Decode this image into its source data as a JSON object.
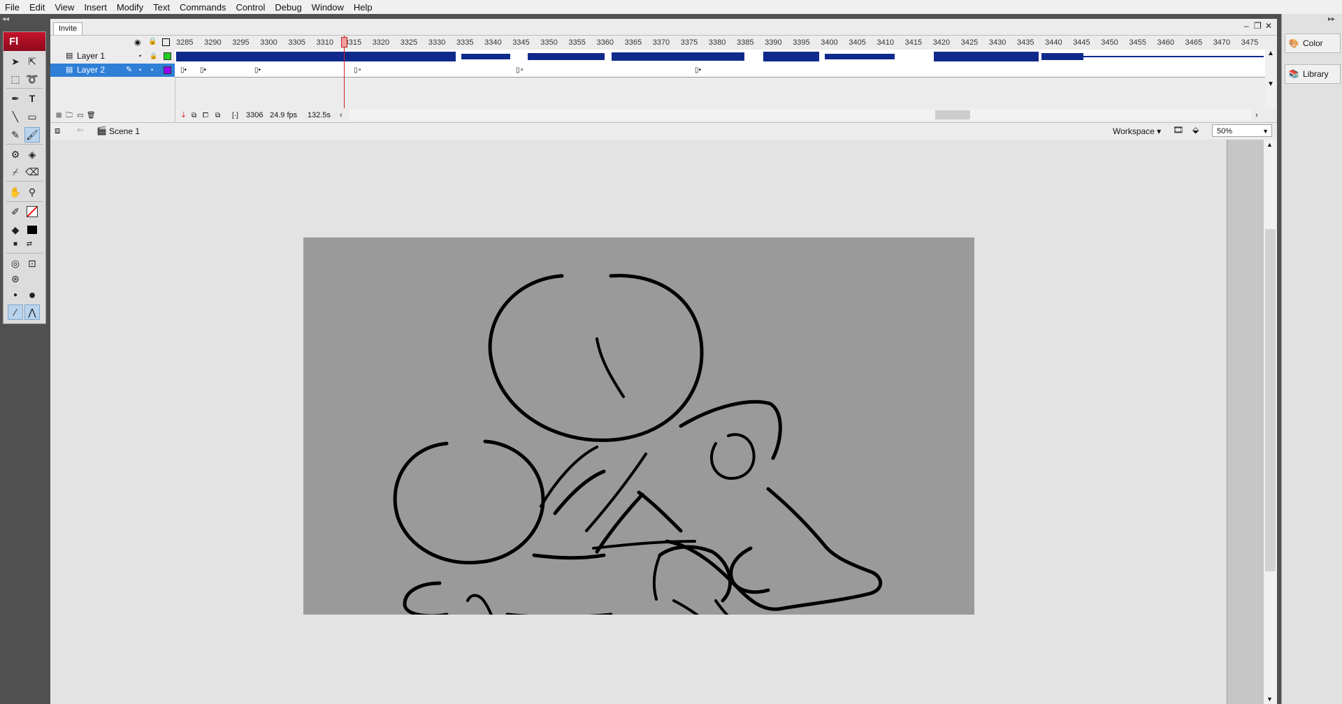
{
  "menu": [
    "File",
    "Edit",
    "View",
    "Insert",
    "Modify",
    "Text",
    "Commands",
    "Control",
    "Debug",
    "Window",
    "Help"
  ],
  "tools": {
    "logo": "Fl"
  },
  "document": {
    "tab": "Invite"
  },
  "timeline": {
    "layers": [
      {
        "name": "Layer 1",
        "color": "#22cc22",
        "selected": false
      },
      {
        "name": "Layer 2",
        "color": "#9900ff",
        "selected": true
      }
    ],
    "frame_ticks": [
      "3285",
      "3290",
      "3295",
      "3300",
      "3305",
      "3310",
      "3315",
      "3320",
      "3325",
      "3330",
      "3335",
      "3340",
      "3345",
      "3350",
      "3355",
      "3360",
      "3365",
      "3370",
      "3375",
      "3380",
      "3385",
      "3390",
      "3395",
      "3400",
      "3405",
      "3410",
      "3415",
      "3420",
      "3425",
      "3430",
      "3435",
      "3440",
      "3445",
      "3450",
      "3455",
      "3460",
      "3465",
      "3470",
      "3475"
    ],
    "status": {
      "frame": "3306",
      "fps": "24.9 fps",
      "time": "132.5s"
    }
  },
  "editbar": {
    "scene": "Scene 1",
    "workspace": "Workspace",
    "zoom": "50%"
  },
  "panels": [
    {
      "label": "Color",
      "icon": "color-icon"
    },
    {
      "label": "Library",
      "icon": "library-icon"
    }
  ],
  "colors": {
    "stage": "#9a9a9a",
    "pasteboard": "#e3e3e3",
    "waveform": "#102a8c",
    "playhead": "#d02020",
    "selection": "#2f7fd7"
  }
}
